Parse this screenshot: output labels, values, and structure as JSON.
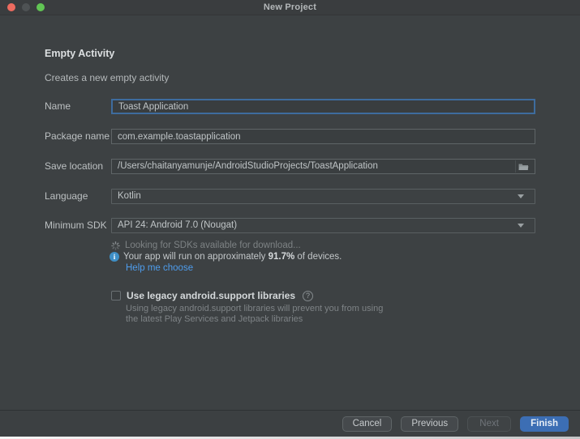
{
  "window": {
    "title": "New Project",
    "traffic_lights": [
      "close",
      "minimize",
      "zoom"
    ]
  },
  "header": {
    "title": "Empty Activity",
    "subtitle": "Creates a new empty activity"
  },
  "form": {
    "name": {
      "label": "Name",
      "value": "Toast Application"
    },
    "package": {
      "label": "Package name",
      "value": "com.example.toastapplication"
    },
    "save_location": {
      "label": "Save location",
      "value": "/Users/chaitanyamunje/AndroidStudioProjects/ToastApplication"
    },
    "language": {
      "label": "Language",
      "value": "Kotlin"
    },
    "min_sdk": {
      "label": "Minimum SDK",
      "value": "API 24: Android 7.0 (Nougat)"
    }
  },
  "sdk_info": {
    "loading_text": "Looking for SDKs available for download...",
    "info_prefix": "Your app will run on approximately ",
    "info_value": "91.7%",
    "info_suffix": " of devices.",
    "info_icon_glyph": "i",
    "help_link": "Help me choose"
  },
  "legacy": {
    "label": "Use legacy android.support libraries",
    "help_icon_glyph": "?",
    "description_line1": "Using legacy android.support libraries will prevent you from using",
    "description_line2": "the latest Play Services and Jetpack libraries"
  },
  "footer": {
    "cancel": "Cancel",
    "previous": "Previous",
    "next": "Next",
    "finish": "Finish"
  },
  "colors": {
    "dialog_background": "#3d4143",
    "titlebar_background": "#3a3d3f",
    "field_border": "#5f6567",
    "focus_border": "#3e6c9e",
    "link_blue": "#4e9ded",
    "info_icon_blue": "#3f8fc6",
    "finish_button_blue": "#3c6eb4",
    "traffic_close_red": "#ed6b5f",
    "traffic_zoom_green": "#61c554",
    "dim_text": "#7e8386"
  }
}
